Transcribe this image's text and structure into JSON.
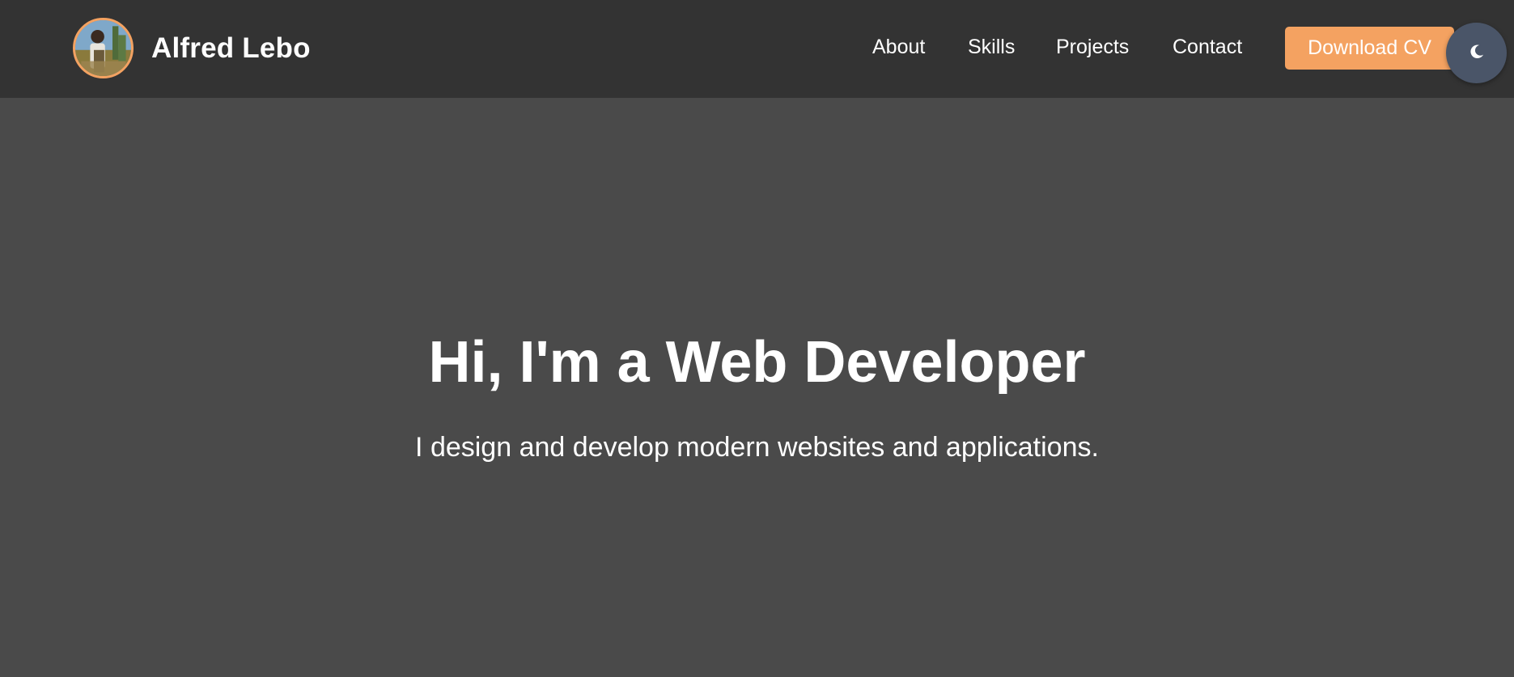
{
  "header": {
    "brand_name": "Alfred Lebo",
    "nav": {
      "about": "About",
      "skills": "Skills",
      "projects": "Projects",
      "contact": "Contact"
    },
    "cv_button": "Download CV",
    "theme_toggle_icon": "moon-icon"
  },
  "hero": {
    "title": "Hi, I'm a Web Developer",
    "subtitle": "I design and develop modern websites and applications."
  },
  "colors": {
    "header_bg": "#333333",
    "page_bg": "#4a4a4a",
    "accent": "#f4a261",
    "toggle_bg": "#4a5568"
  }
}
